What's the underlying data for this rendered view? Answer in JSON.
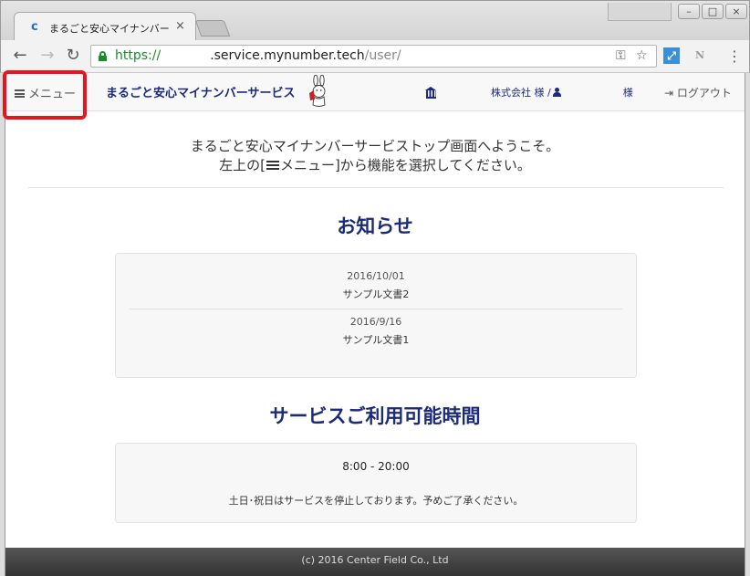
{
  "browser": {
    "tab_title": "まるごと安心マイナンバー",
    "tab_close": "×",
    "url_scheme": "https://",
    "url_host": ".service.mynumber.tech",
    "url_path": "/user/",
    "window_controls": {
      "minimize": "–",
      "maximize": "□",
      "close": "×"
    },
    "ext2_label": "N"
  },
  "nav": {
    "menu_label": "メニュー",
    "brand": "まるごと安心マイナンバーサービス",
    "company_suffix": "株式会社 様 /",
    "user_suffix": "様",
    "logout_label": "ログアウト"
  },
  "welcome": {
    "line1": "まるごと安心マイナンバーサービストップ画面へようこそ。",
    "line2_before": "左上の[",
    "line2_menu": "メニュー",
    "line2_after": "]から機能を選択してください。"
  },
  "news": {
    "title": "お知らせ",
    "items": [
      {
        "date": "2016/10/01",
        "text": "サンプル文書2"
      },
      {
        "date": "2016/9/16",
        "text": "サンプル文書1"
      }
    ]
  },
  "hours": {
    "title": "サービスご利用可能時間",
    "time": "8:00 - 20:00",
    "note": "土日･祝日はサービスを停止しております。予めご了承ください。"
  },
  "footer": {
    "text": "(c) 2016 Center Field Co., Ltd"
  },
  "colors": {
    "brand": "#1c2a7a",
    "highlight": "#e8141e",
    "secure": "#1a8c2a"
  }
}
